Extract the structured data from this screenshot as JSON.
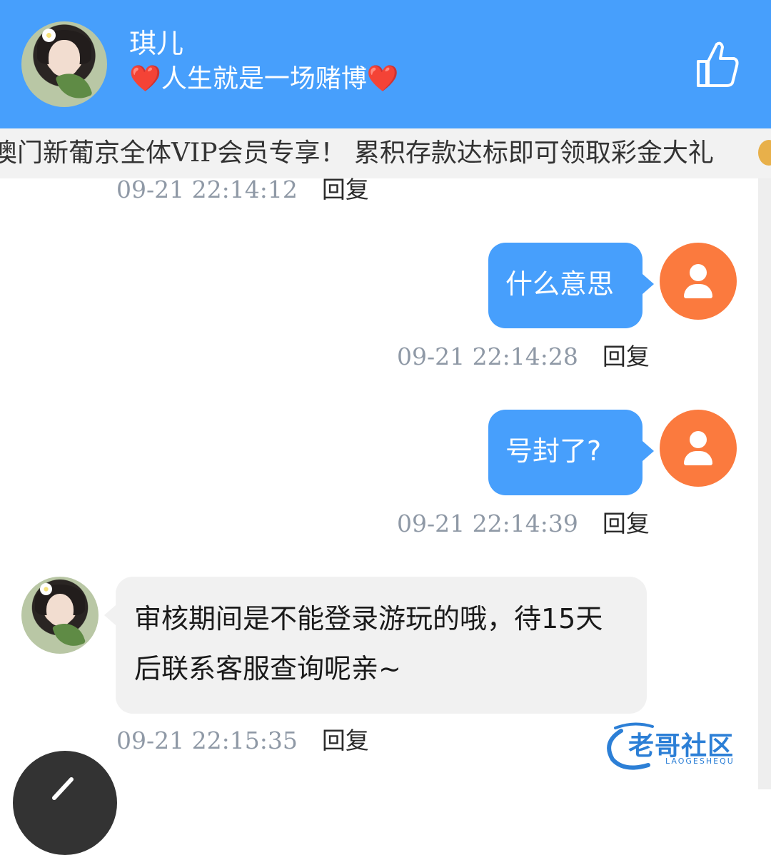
{
  "header": {
    "name": "琪儿",
    "signature_heart_left": "❤️",
    "signature": "人生就是一场赌博",
    "signature_heart_right": "❤️",
    "like_icon": "thumbs-up-icon"
  },
  "marquee": {
    "text": "澳门新葡京全体VIP会员专享！ 累积存款达标即可领取彩金大礼"
  },
  "messages": [
    {
      "side": "left",
      "time": "09-21 22:14:12",
      "reply": "回复"
    },
    {
      "side": "right",
      "text": "什么意思",
      "time": "09-21 22:14:28",
      "reply": "回复"
    },
    {
      "side": "right",
      "text": "号封了?",
      "time": "09-21 22:14:39",
      "reply": "回复"
    },
    {
      "side": "left",
      "text": "审核期间是不能登录游玩的哦，待15天后联系客服查询呢亲~",
      "time": "09-21 22:15:35",
      "reply": "回复"
    }
  ],
  "watermark": {
    "text": "老哥社区",
    "subtext": "LAOGESHEQU"
  },
  "colors": {
    "header_bg": "#479ffc",
    "bubble_right": "#479ffc",
    "bubble_left": "#f1f1f1",
    "user_avatar": "#fb7a3e",
    "timestamp": "#8f99a6"
  },
  "icons": {
    "fab": "edit-pencil-icon",
    "user_avatar": "user-silhouette-icon"
  }
}
